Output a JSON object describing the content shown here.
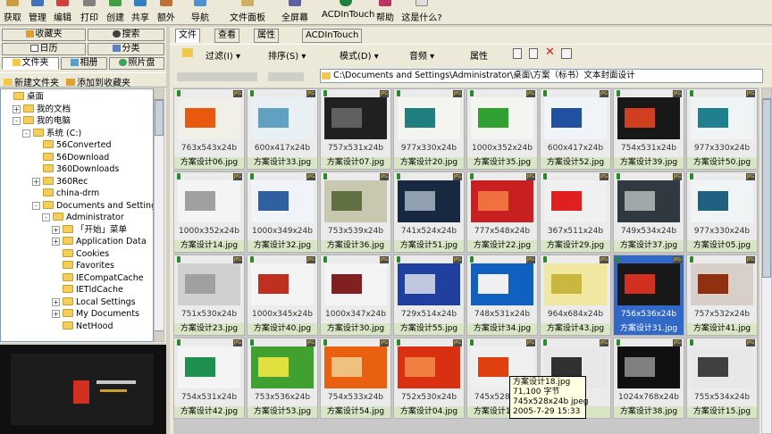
{
  "toolbar": {
    "items": [
      {
        "label": "获取",
        "icon": "acquire-icon"
      },
      {
        "label": "管理",
        "icon": "manage-icon"
      },
      {
        "label": "编辑",
        "icon": "edit-icon"
      },
      {
        "label": "打印",
        "icon": "print-icon"
      },
      {
        "label": "创建",
        "icon": "create-icon"
      },
      {
        "label": "共享",
        "icon": "share-icon"
      },
      {
        "label": "额外",
        "icon": "extra-icon"
      },
      {
        "label": "导航",
        "icon": "navigate-icon"
      },
      {
        "label": "文件面板",
        "icon": "file-panel-icon"
      },
      {
        "label": "全屏幕",
        "icon": "fullscreen-icon"
      },
      {
        "label": "ACDInTouch",
        "icon": "acdintouch-icon"
      },
      {
        "label": "帮助",
        "icon": "help-icon"
      },
      {
        "label": "这是什么?",
        "icon": "whats-this-icon"
      }
    ]
  },
  "left_tabs": {
    "row1": [
      "收藏夹",
      "搜索"
    ],
    "row2": [
      "日历",
      "分类"
    ],
    "row3": [
      "文件夹",
      "相册",
      "照片盘"
    ]
  },
  "left_toolbar": {
    "new_folder": "新建文件夹",
    "add_favorite": "添加到收藏夹"
  },
  "tree": [
    {
      "label": "桌面",
      "level": 0,
      "expander": ""
    },
    {
      "label": "我的文档",
      "level": 1,
      "expander": "+"
    },
    {
      "label": "我的电脑",
      "level": 1,
      "expander": "-"
    },
    {
      "label": "系统 (C:)",
      "level": 2,
      "expander": "-"
    },
    {
      "label": "56Converted",
      "level": 3,
      "expander": ""
    },
    {
      "label": "56Download",
      "level": 3,
      "expander": ""
    },
    {
      "label": "360Downloads",
      "level": 3,
      "expander": ""
    },
    {
      "label": "360Rec",
      "level": 3,
      "expander": "+"
    },
    {
      "label": "china-drm",
      "level": 3,
      "expander": ""
    },
    {
      "label": "Documents and Settings",
      "level": 3,
      "expander": "-"
    },
    {
      "label": "Administrator",
      "level": 4,
      "expander": "-"
    },
    {
      "label": "「开始」菜单",
      "level": 5,
      "expander": "+"
    },
    {
      "label": "Application Data",
      "level": 5,
      "expander": "+"
    },
    {
      "label": "Cookies",
      "level": 5,
      "expander": ""
    },
    {
      "label": "Favorites",
      "level": 5,
      "expander": ""
    },
    {
      "label": "IECompatCache",
      "level": 5,
      "expander": ""
    },
    {
      "label": "IETldCache",
      "level": 5,
      "expander": ""
    },
    {
      "label": "Local Settings",
      "level": 5,
      "expander": "+"
    },
    {
      "label": "My Documents",
      "level": 5,
      "expander": "+"
    },
    {
      "label": "NetHood",
      "level": 5,
      "expander": ""
    }
  ],
  "right_tabs": [
    "文件",
    "查看",
    "属性",
    "ACDInTouch"
  ],
  "right_toolbar": {
    "filter": "过滤(I)",
    "sort": "排序(S)",
    "mode": "模式(D)",
    "audio": "音频",
    "properties": "属性"
  },
  "address": "C:\\Documents and Settings\\Administrator\\桌面\\方案（标书）文本封面设计",
  "thumbnails": [
    {
      "dims": "763x543x24b",
      "name": "方案设计06.jpg",
      "bg": "#f0f0e8",
      "accent": "#e85a10"
    },
    {
      "dims": "600x417x24b",
      "name": "方案设计33.jpg",
      "bg": "#e8f0f4",
      "accent": "#60a0c0"
    },
    {
      "dims": "757x531x24b",
      "name": "方案设计07.jpg",
      "bg": "#202020",
      "accent": "#606060"
    },
    {
      "dims": "977x330x24b",
      "name": "方案设计20.jpg",
      "bg": "#f4f4f0",
      "accent": "#208080"
    },
    {
      "dims": "1000x352x24b",
      "name": "方案设计35.jpg",
      "bg": "#f4f4f0",
      "accent": "#30a030"
    },
    {
      "dims": "600x417x24b",
      "name": "方案设计52.jpg",
      "bg": "#f0f4f8",
      "accent": "#2050a0"
    },
    {
      "dims": "754x531x24b",
      "name": "方案设计39.jpg",
      "bg": "#181818",
      "accent": "#d04020"
    },
    {
      "dims": "977x330x24b",
      "name": "方案设计50.jpg",
      "bg": "#f0f4f4",
      "accent": "#208090"
    },
    {
      "dims": "1000x352x24b",
      "name": "方案设计14.jpg",
      "bg": "#f4f4f4",
      "accent": "#a0a0a0"
    },
    {
      "dims": "1000x349x24b",
      "name": "方案设计32.jpg",
      "bg": "#f0f4f8",
      "accent": "#3060a0"
    },
    {
      "dims": "753x539x24b",
      "name": "方案设计36.jpg",
      "bg": "#c8c8b0",
      "accent": "#607040"
    },
    {
      "dims": "741x524x24b",
      "name": "方案设计51.jpg",
      "bg": "#182840",
      "accent": "#90a0b0"
    },
    {
      "dims": "777x548x24b",
      "name": "方案设计22.jpg",
      "bg": "#c82020",
      "accent": "#f07040"
    },
    {
      "dims": "367x511x24b",
      "name": "方案设计29.jpg",
      "bg": "#f0f0f0",
      "accent": "#e02020"
    },
    {
      "dims": "749x534x24b",
      "name": "方案设计37.jpg",
      "bg": "#303840",
      "accent": "#a0a8a8"
    },
    {
      "dims": "977x330x24b",
      "name": "方案设计05.jpg",
      "bg": "#f0f4f4",
      "accent": "#206080"
    },
    {
      "dims": "751x530x24b",
      "name": "方案设计23.jpg",
      "bg": "#d0d0d0",
      "accent": "#a0a0a0"
    },
    {
      "dims": "1000x345x24b",
      "name": "方案设计40.jpg",
      "bg": "#f4f4f4",
      "accent": "#c03020"
    },
    {
      "dims": "1000x347x24b",
      "name": "方案设计30.jpg",
      "bg": "#f4f4f4",
      "accent": "#802020"
    },
    {
      "dims": "729x514x24b",
      "name": "方案设计55.jpg",
      "bg": "#2040a0",
      "accent": "#c0c8e0"
    },
    {
      "dims": "748x531x24b",
      "name": "方案设计34.jpg",
      "bg": "#1060c0",
      "accent": "#f0f0f0"
    },
    {
      "dims": "964x684x24b",
      "name": "方案设计43.jpg",
      "bg": "#f0e8a0",
      "accent": "#c8b840"
    },
    {
      "dims": "756x536x24b",
      "name": "方案设计31.jpg",
      "bg": "#181818",
      "accent": "#d03020"
    },
    {
      "dims": "757x532x24b",
      "name": "方案设计41.jpg",
      "bg": "#d8d0c8",
      "accent": "#903010"
    },
    {
      "dims": "754x531x24b",
      "name": "方案设计42.jpg",
      "bg": "#f4f4f4",
      "accent": "#209050"
    },
    {
      "dims": "753x536x24b",
      "name": "方案设计53.jpg",
      "bg": "#40a030",
      "accent": "#e0e040"
    },
    {
      "dims": "754x533x24b",
      "name": "方案设计54.jpg",
      "bg": "#e86010",
      "accent": "#f0c080"
    },
    {
      "dims": "752x530x24b",
      "name": "方案设计04.jpg",
      "bg": "#d83010",
      "accent": "#f08040"
    },
    {
      "dims": "745x528x24b",
      "name": "方案设计18.jpg",
      "bg": "#f0f0f0",
      "accent": "#e04010"
    },
    {
      "dims": "",
      "name": "",
      "bg": "#e8e8e8",
      "accent": "#303030"
    },
    {
      "dims": "1024x768x24b",
      "name": "方案设计38.jpg",
      "bg": "#101010",
      "accent": "#808080"
    },
    {
      "dims": "755x534x24b",
      "name": "方案设计15.jpg",
      "bg": "#e8e8e8",
      "accent": "#404040"
    }
  ],
  "selected_index": 22,
  "tooltip": {
    "name": "方案设计18.jpg",
    "size": "71,100 字节",
    "dims": "745x528x24b jpeg",
    "date": "2005-7-29 15:33"
  },
  "badge": {
    "jpg": "JPG"
  }
}
